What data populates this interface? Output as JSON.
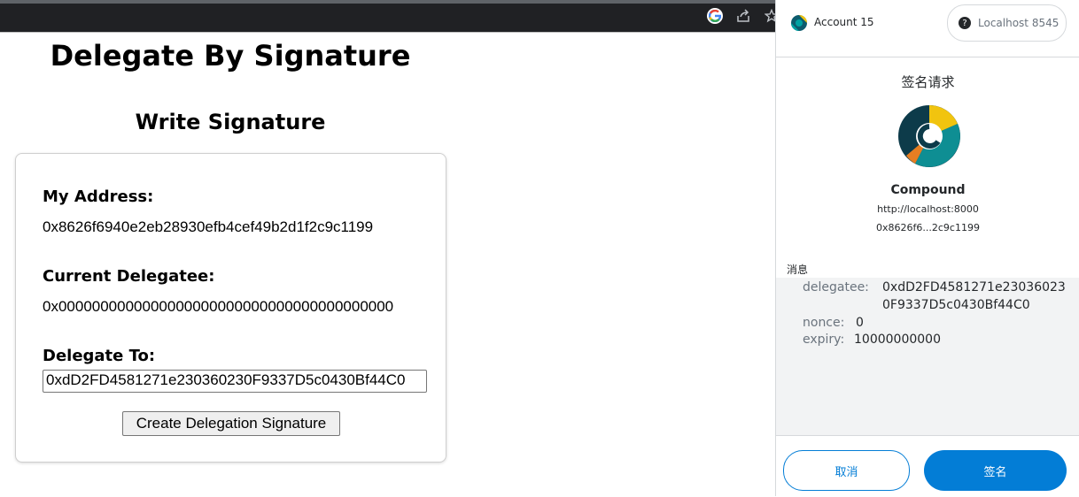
{
  "page": {
    "title": "Delegate By Signature",
    "section_title": "Write Signature",
    "my_address_label": "My Address:",
    "my_address_value": "0x8626f6940e2eb28930efb4cef49b2d1f2c9c1199",
    "current_delegatee_label": "Current Delegatee:",
    "current_delegatee_value": "0x0000000000000000000000000000000000000000",
    "delegate_to_label": "Delegate To:",
    "delegate_to_value": "0xdD2FD4581271e230360230F9337D5c0430Bf44C0",
    "create_button_label": "Create Delegation Signature"
  },
  "metamask": {
    "account_name": "Account 15",
    "network_name": "Localhost 8545",
    "request_title": "签名请求",
    "site_name": "Compound",
    "site_url": "http://localhost:8000",
    "site_address": "0x8626f6...2c9c1199",
    "message_label": "消息",
    "message": {
      "delegatee_key": "delegatee:",
      "delegatee_value_line1": "0xdD2FD4581271e23036023",
      "delegatee_value_line2": "0F9337D5c0430Bf44C0",
      "nonce_key": "nonce:",
      "nonce_value": "0",
      "expiry_key": "expiry:",
      "expiry_value": "10000000000"
    },
    "cancel_label": "取消",
    "sign_label": "签名"
  },
  "colors": {
    "metamask_blue": "#037dd6",
    "compound_yellow": "#f1c40f",
    "compound_teal": "#00a3a3",
    "compound_dark": "#0d3b4a"
  },
  "icons": [
    "google-icon",
    "share-icon",
    "star-icon",
    "account-icon",
    "network-unknown-icon",
    "compound-logo"
  ]
}
